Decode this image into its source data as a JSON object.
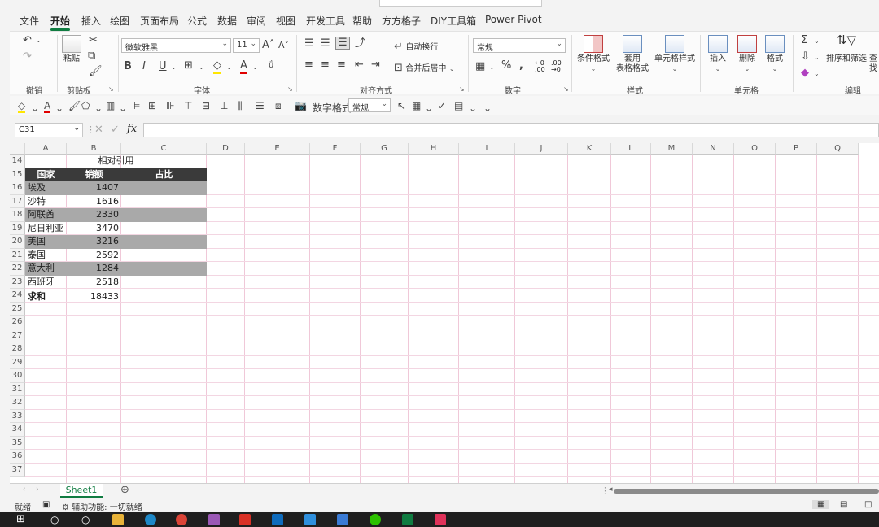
{
  "tabs": [
    "文件",
    "开始",
    "插入",
    "绘图",
    "页面布局",
    "公式",
    "数据",
    "审阅",
    "视图",
    "开发工具",
    "帮助",
    "方方格子",
    "DIY工具箱",
    "Power Pivot"
  ],
  "active_tab": "开始",
  "ribbon": {
    "undo_group": "撤销",
    "clipboard": {
      "label": "剪贴板",
      "paste": "粘贴"
    },
    "font": {
      "label": "字体",
      "font_name": "微软雅黑",
      "font_size": "11"
    },
    "align": {
      "label": "对齐方式",
      "wrap": "自动换行",
      "merge": "合并后居中"
    },
    "number": {
      "label": "数字",
      "format": "常规"
    },
    "styles": {
      "label": "样式",
      "conditional": "条件格式",
      "table_fmt_1": "套用",
      "table_fmt_2": "表格格式",
      "cell_style": "单元格样式"
    },
    "cells": {
      "label": "单元格",
      "insert": "插入",
      "delete": "删除",
      "format": "格式"
    },
    "editing": {
      "label": "编辑",
      "sort": "排序和筛选",
      "find": "查找"
    }
  },
  "qat": {
    "num_format_label": "数字格式",
    "num_format_value": "常规"
  },
  "formula_bar": {
    "name_box": "C31",
    "fx": "fx",
    "value": ""
  },
  "columns": [
    "A",
    "B",
    "C",
    "D",
    "E",
    "F",
    "G",
    "H",
    "I",
    "J",
    "K",
    "L",
    "M",
    "N",
    "O",
    "P",
    "Q"
  ],
  "rows": [
    "14",
    "15",
    "16",
    "17",
    "18",
    "19",
    "20",
    "21",
    "22",
    "23",
    "24",
    "25",
    "26",
    "27",
    "28",
    "29",
    "30",
    "31",
    "32",
    "33",
    "34",
    "35",
    "36",
    "37"
  ],
  "table": {
    "title": "相对引用",
    "headers": [
      "国家",
      "销额",
      "占比"
    ],
    "data": [
      [
        "埃及",
        "1407"
      ],
      [
        "沙特",
        "1616"
      ],
      [
        "阿联酋",
        "2330"
      ],
      [
        "尼日利亚",
        "3470"
      ],
      [
        "美国",
        "3216"
      ],
      [
        "泰国",
        "2592"
      ],
      [
        "意大利",
        "1284"
      ],
      [
        "西班牙",
        "2518"
      ]
    ],
    "total_label": "求和",
    "total_value": "18433"
  },
  "sheet_tabs": [
    "Sheet1"
  ],
  "status": {
    "ready": "就绪",
    "accessibility": "辅助功能: 一切就绪"
  },
  "colors": {
    "accent": "#107c41",
    "band": "#a9a9a9",
    "header_fill": "#3a3a3a"
  }
}
